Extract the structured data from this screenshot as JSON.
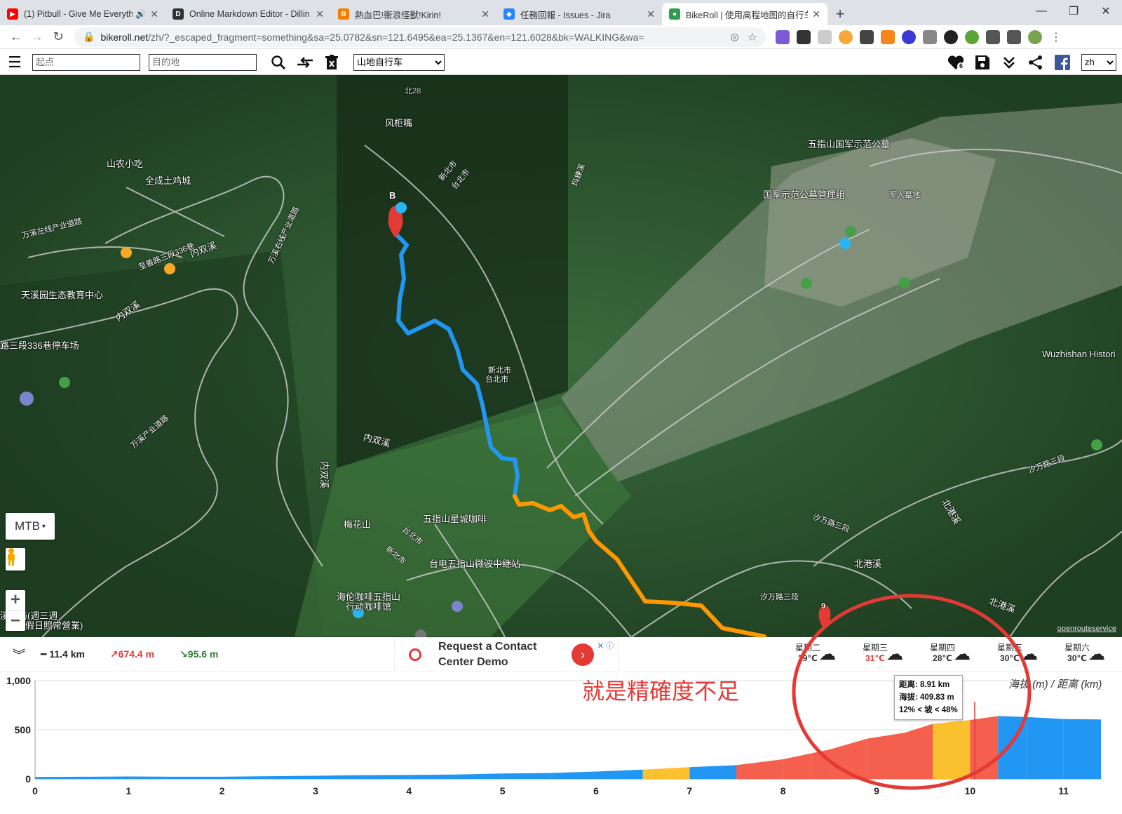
{
  "browser": {
    "tabs": [
      {
        "title": "(1) Pitbull - Give Me Everyth",
        "favicon_color": "#ff0000",
        "favicon_glyph": "▶",
        "audio": true
      },
      {
        "title": "Online Markdown Editor - Dillin",
        "favicon_color": "#333333",
        "favicon_glyph": "D"
      },
      {
        "title": "熱血巴!衝浪怪獸!Kirin!",
        "favicon_color": "#f57d00",
        "favicon_glyph": "B"
      },
      {
        "title": "任務回報 - Issues - Jira",
        "favicon_color": "#2684ff",
        "favicon_glyph": "◆"
      },
      {
        "title": "BikeRoll | 使用高程地图的自行车",
        "favicon_color": "#2e9d4d",
        "favicon_glyph": "●",
        "active": true
      }
    ],
    "url_host": "bikeroll.net",
    "url_path": "/zh/?_escaped_fragment=something&sa=25.0782&sn=121.6495&ea=25.1367&en=121.6028&bk=WALKING&wa="
  },
  "toolbar": {
    "start_placeholder": "起点",
    "dest_placeholder": "目的地",
    "bike_type": "山地自行车",
    "bike_options": [
      "山地自行车"
    ],
    "language": "zh",
    "favorites_count": "6"
  },
  "map": {
    "labels": {
      "fenggui": "风柜嘴",
      "shannong": "山农小吃",
      "quancheng": "全成土鸡城",
      "wuzhishan_cemetery": "五指山国军示范公墓",
      "cemetery_mgmt": "国军示范公墓管理组",
      "junren": "军人墓地",
      "tianxi": "天溪园生态教育中心",
      "parking": "路三段336巷停车场",
      "neishuangxi1": "内双溪",
      "neishuangxi2": "内双溪",
      "neishuangxi3": "内双溪",
      "neishuangxi4": "内双溪",
      "meihuashan": "梅花山",
      "xingcheng": "五指山星城咖啡",
      "taidian": "台电五指山微波中继站",
      "hailun1": "海伦咖啡五指山",
      "hailun2": "行动咖啡馆",
      "beigangxi": "北港溪",
      "beigangxi2": "北港溪",
      "beigangxi3": "北港溪",
      "xiwan": "汐万路三段",
      "xiwan2": "汐万路三段",
      "xiwan3": "汐万路三段",
      "wuzhishan_hist": "Wuzhishan Histori",
      "taibei": "台北市",
      "taibei2": "台北市",
      "xinbei": "新北市",
      "xinbei2": "新北市",
      "taibei3": "台北市",
      "xinbei3": "新北市",
      "zhishan336": "至善路三段336巷",
      "wanxi": "万溪产业道路",
      "yuxi": "玛鍊溪",
      "bei28": "北28",
      "restaurant": "溪餐坊(週三週",
      "restaurant2": "国定假日照常營業)",
      "wanxi_right": "万溪右线产业道路",
      "wanxi_left": "万溪左线产业道路"
    },
    "mode_label": "MTB",
    "marker_b": "B",
    "marker_9": "9",
    "attribution": "openrouteservice"
  },
  "summary": {
    "distance": "11.4 km",
    "ascent": "674.4 m",
    "descent": "95.6 m"
  },
  "ad": {
    "line1": "Request a Contact",
    "line2": "Center Demo"
  },
  "weather": [
    {
      "day": "星期二",
      "temp": "29℃",
      "hot": false
    },
    {
      "day": "星期三",
      "temp": "31℃",
      "hot": true
    },
    {
      "day": "星期四",
      "temp": "28℃",
      "hot": false
    },
    {
      "day": "星期五",
      "temp": "30℃",
      "hot": false
    },
    {
      "day": "星期六",
      "temp": "30℃",
      "hot": false
    }
  ],
  "annotation": "就是精確度不足",
  "chart_axis_label": "海拔 (m) / 距离 (km)",
  "tooltip": {
    "distance": "距离: 8.91 km",
    "elevation": "海拔: 409.83 m",
    "slope": "12% < 坡 < 48%"
  },
  "chart_data": {
    "type": "area",
    "xlabel": "距离 (km)",
    "ylabel": "海拔 (m)",
    "xlim": [
      0,
      11.4
    ],
    "ylim": [
      0,
      1000
    ],
    "x_ticks": [
      "0",
      "1",
      "2",
      "3",
      "4",
      "5",
      "6",
      "7",
      "8",
      "9",
      "10",
      "11"
    ],
    "y_ticks": [
      "0",
      "500",
      "1,000"
    ],
    "x": [
      0,
      0.5,
      1,
      1.5,
      2,
      2.5,
      3,
      3.5,
      4,
      4.5,
      5,
      5.5,
      6,
      6.5,
      7,
      7.5,
      8,
      8.3,
      8.5,
      8.9,
      9.3,
      9.6,
      10,
      10.3,
      10.6,
      11,
      11.4
    ],
    "y": [
      20,
      22,
      25,
      22,
      22,
      28,
      32,
      38,
      40,
      45,
      55,
      60,
      75,
      95,
      120,
      140,
      200,
      260,
      300,
      410,
      470,
      560,
      600,
      640,
      630,
      610,
      605
    ],
    "slope_colors": {
      "flat": "#2196f3",
      "moderate": "#fbc02d",
      "steep": "#f4604d"
    }
  },
  "colors": {
    "route_blue": "#2196f3",
    "route_orange": "#ff9800",
    "annotation_red": "#e53935"
  }
}
